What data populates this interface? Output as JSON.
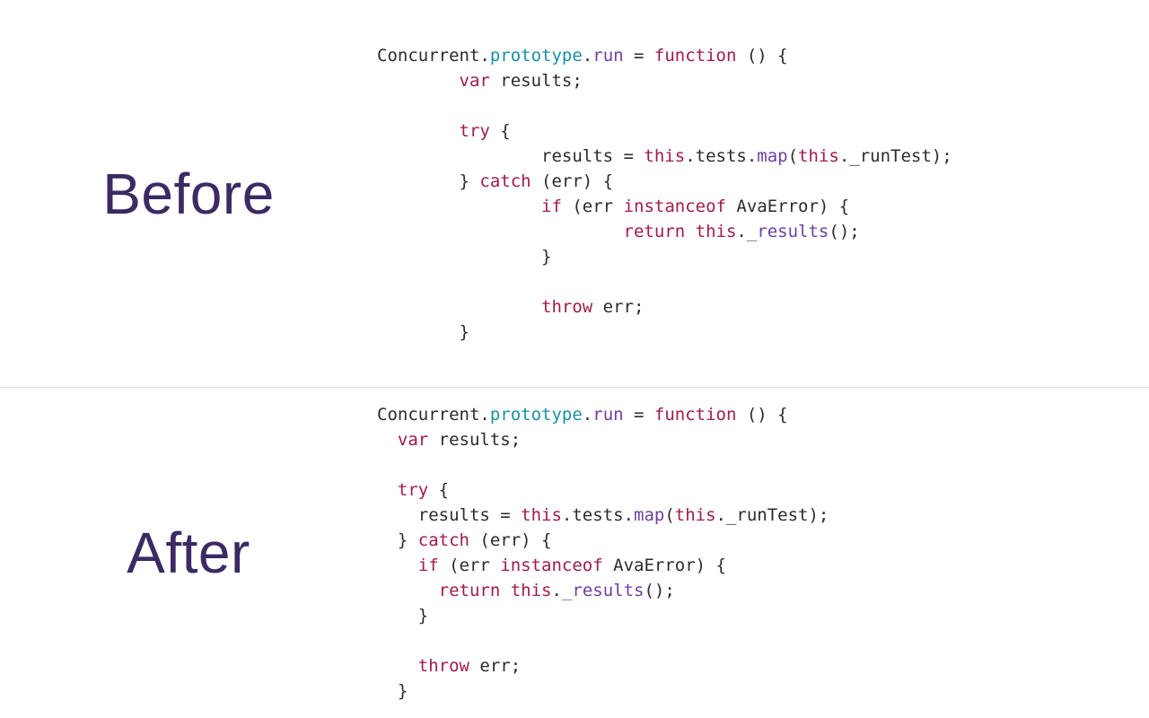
{
  "labels": {
    "before": "Before",
    "after": "After"
  },
  "code": {
    "line1": {
      "a": "Concurrent",
      "b": ".",
      "c": "prototype",
      "d": ".",
      "e": "run",
      "f": " = ",
      "g": "function",
      "h": " () {"
    },
    "line2": {
      "a": "\t",
      "b": "var",
      "c": " results;"
    },
    "line3": "",
    "line4": {
      "a": "\t",
      "b": "try",
      "c": " {"
    },
    "line5": {
      "a": "\t\tresults = ",
      "b": "this",
      "c": ".tests.",
      "d": "map",
      "e": "(",
      "f": "this",
      "g": "._runTest);"
    },
    "line6": {
      "a": "\t} ",
      "b": "catch",
      "c": " (err) {"
    },
    "line7": {
      "a": "\t\t",
      "b": "if",
      "c": " (err ",
      "d": "instanceof",
      "e": " AvaError) {"
    },
    "line8": {
      "a": "\t\t\t",
      "b": "return",
      "c": " ",
      "d": "this",
      "e": ".",
      "f": "_results",
      "g": "();"
    },
    "line9": "\t\t}",
    "line10": "",
    "line11": {
      "a": "\t\t",
      "b": "throw",
      "c": " err;"
    },
    "line12": "\t}"
  }
}
